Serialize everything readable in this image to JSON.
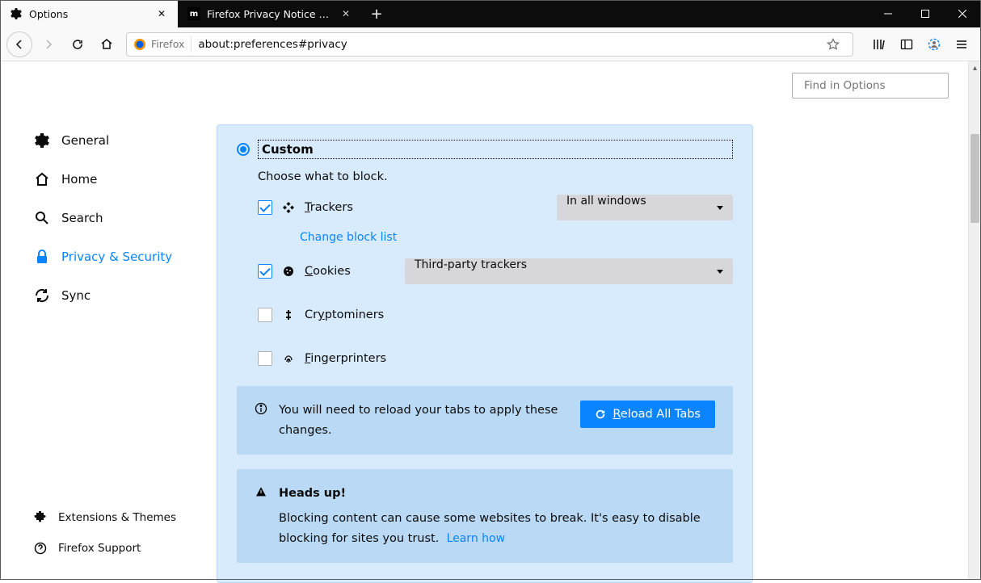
{
  "window": {
    "tabs": [
      {
        "label": "Options",
        "active": true
      },
      {
        "label": "Firefox Privacy Notice — Mozilla",
        "active": false
      }
    ]
  },
  "toolbar": {
    "identity_label": "Firefox",
    "url": "about:preferences#privacy"
  },
  "search": {
    "placeholder": "Find in Options"
  },
  "sidebar": {
    "items": [
      {
        "label": "General"
      },
      {
        "label": "Home"
      },
      {
        "label": "Search"
      },
      {
        "label": "Privacy & Security"
      },
      {
        "label": "Sync"
      }
    ],
    "bottom": [
      {
        "label": "Extensions & Themes"
      },
      {
        "label": "Firefox Support"
      }
    ]
  },
  "panel": {
    "title": "Custom",
    "subtitle": "Choose what to block.",
    "options": {
      "trackers": {
        "label": "Trackers",
        "checked": true,
        "dropdown": "In all windows"
      },
      "change_block_list": "Change block list",
      "cookies": {
        "label": "Cookies",
        "checked": true,
        "dropdown": "Third-party trackers"
      },
      "cryptominers": {
        "label": "Cryptominers",
        "checked": false
      },
      "fingerprinters": {
        "label": "Fingerprinters",
        "checked": false
      }
    },
    "reload_box": {
      "text": "You will need to reload your tabs to apply these changes.",
      "button": "Reload All Tabs"
    },
    "headsup": {
      "title": "Heads up!",
      "text": "Blocking content can cause some websites to break. It's easy to disable blocking for sites you trust.",
      "link": "Learn how"
    }
  }
}
